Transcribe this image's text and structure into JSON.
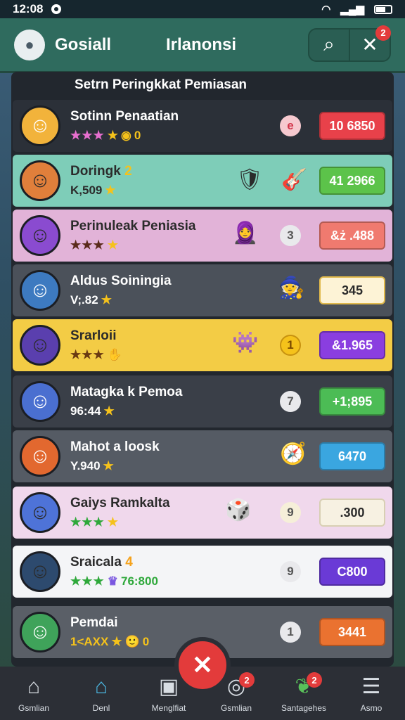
{
  "status": {
    "time": "12:08"
  },
  "header": {
    "user_name": "Gosiall",
    "title": "Irlanonsi",
    "close_badge": "2"
  },
  "panel": {
    "title": "Setrn Peringkkat Pemiasan"
  },
  "rows": [
    {
      "name": "Sotinn Penaatian",
      "sub": "0",
      "rank": "e",
      "score": "10 6850",
      "bg": "#2b3038",
      "text": "#ffffff",
      "score_bg": "#e8414a"
    },
    {
      "name": "Doringk",
      "sub": "K,509",
      "rank": "",
      "score": "41 2966",
      "bg": "#7ecdb8",
      "text": "#2b2b2b",
      "score_bg": "#5cc34a"
    },
    {
      "name": "Perinuleak Peniasia",
      "sub": "",
      "rank": "3",
      "score": "&ż .488",
      "bg": "#e2b3d8",
      "text": "#2b2b2b",
      "score_bg": "#f07a6f"
    },
    {
      "name": "Aldus Soiningia",
      "sub": "V;.82",
      "rank": "",
      "score": "345",
      "bg": "#4b515a",
      "text": "#ffffff",
      "score_bg": "#fdf3d6"
    },
    {
      "name": "Srarloii",
      "sub": "",
      "rank": "1",
      "score": "&1.965",
      "bg": "#f3cc45",
      "text": "#2b2b2b",
      "score_bg": "#8a3ee0"
    },
    {
      "name": "Matagka k Pemoa",
      "sub": "96:44",
      "rank": "7",
      "score": "+1;895",
      "bg": "#3a3f48",
      "text": "#ffffff",
      "score_bg": "#4cbc55"
    },
    {
      "name": "Mahot a loosk",
      "sub": "Y.940",
      "rank": "",
      "score": "6470",
      "bg": "#555b64",
      "text": "#ffffff",
      "score_bg": "#3aa6e0"
    },
    {
      "name": "Gaiys Ramkalta",
      "sub": "",
      "rank": "9",
      "score": ".300",
      "bg": "#f0d8ec",
      "text": "#2b2b2b",
      "score_bg": "#f7f1e2"
    },
    {
      "name": "Sraicala",
      "sub": "76:800",
      "rank": "9",
      "score": "C800",
      "bg": "#f4f5f7",
      "text": "#2b2b2b",
      "score_bg": "#6a3ad6"
    },
    {
      "name": "Pemdai",
      "sub": "0",
      "rank": "1",
      "score": "3441",
      "bg": "#5a5f67",
      "text": "#ffffff",
      "score_bg": "#ea7230"
    }
  ],
  "nav": [
    {
      "label": "Gsmlian",
      "icon": "home-icon",
      "badge": ""
    },
    {
      "label": "Denl",
      "icon": "home-active-icon",
      "badge": ""
    },
    {
      "label": "Menglfiat",
      "icon": "mask-icon",
      "badge": ""
    },
    {
      "label": "Gsmlian",
      "icon": "ring-icon",
      "badge": "2"
    },
    {
      "label": "Santagehes",
      "icon": "leaf-icon",
      "badge": "2"
    },
    {
      "label": "Asmo",
      "icon": "menu-icon",
      "badge": ""
    }
  ],
  "accent": "#e33b3b"
}
